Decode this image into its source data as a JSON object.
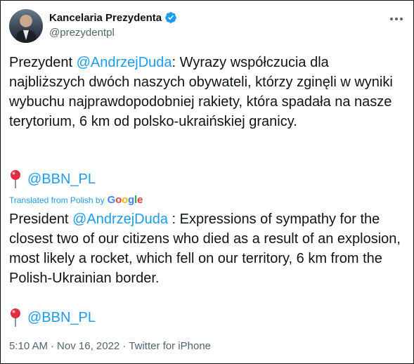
{
  "author": {
    "name": "Kancelaria Prezydenta",
    "handle": "@prezydentpl",
    "verified": true,
    "verified_color": "#1d9bf0"
  },
  "tweet": {
    "prefix": "Prezydent ",
    "mention": "@AndrzejDuda",
    "body": ": Wyrazy współczucia dla najbliższych dwóch naszych obywateli, którzy zginęli w wyniki wybuchu najprawdopodobniej rakiety, która spadała na nasze terytorium, 6 km od polsko-ukraińskiej granicy.",
    "link": "@BBN_PL",
    "pin_icon": "round-pushpin-icon"
  },
  "translation_label": {
    "text": "Translated from Polish by",
    "brand": [
      "G",
      "o",
      "o",
      "g",
      "l",
      "e"
    ]
  },
  "translation": {
    "prefix": "President ",
    "mention": "@AndrzejDuda",
    "body": " : Expressions of sympathy for the closest two of our citizens who died as a result of an explosion, most likely a rocket, which fell on our territory, 6 km from the Polish-Ukrainian border.",
    "link": "@BBN_PL"
  },
  "meta": {
    "time": "5:10 AM",
    "date": "Nov 16, 2022",
    "source": "Twitter for iPhone",
    "separator": "·"
  },
  "colors": {
    "accent": "#1d9bf0",
    "text": "#0f1419",
    "secondary": "#536471"
  }
}
